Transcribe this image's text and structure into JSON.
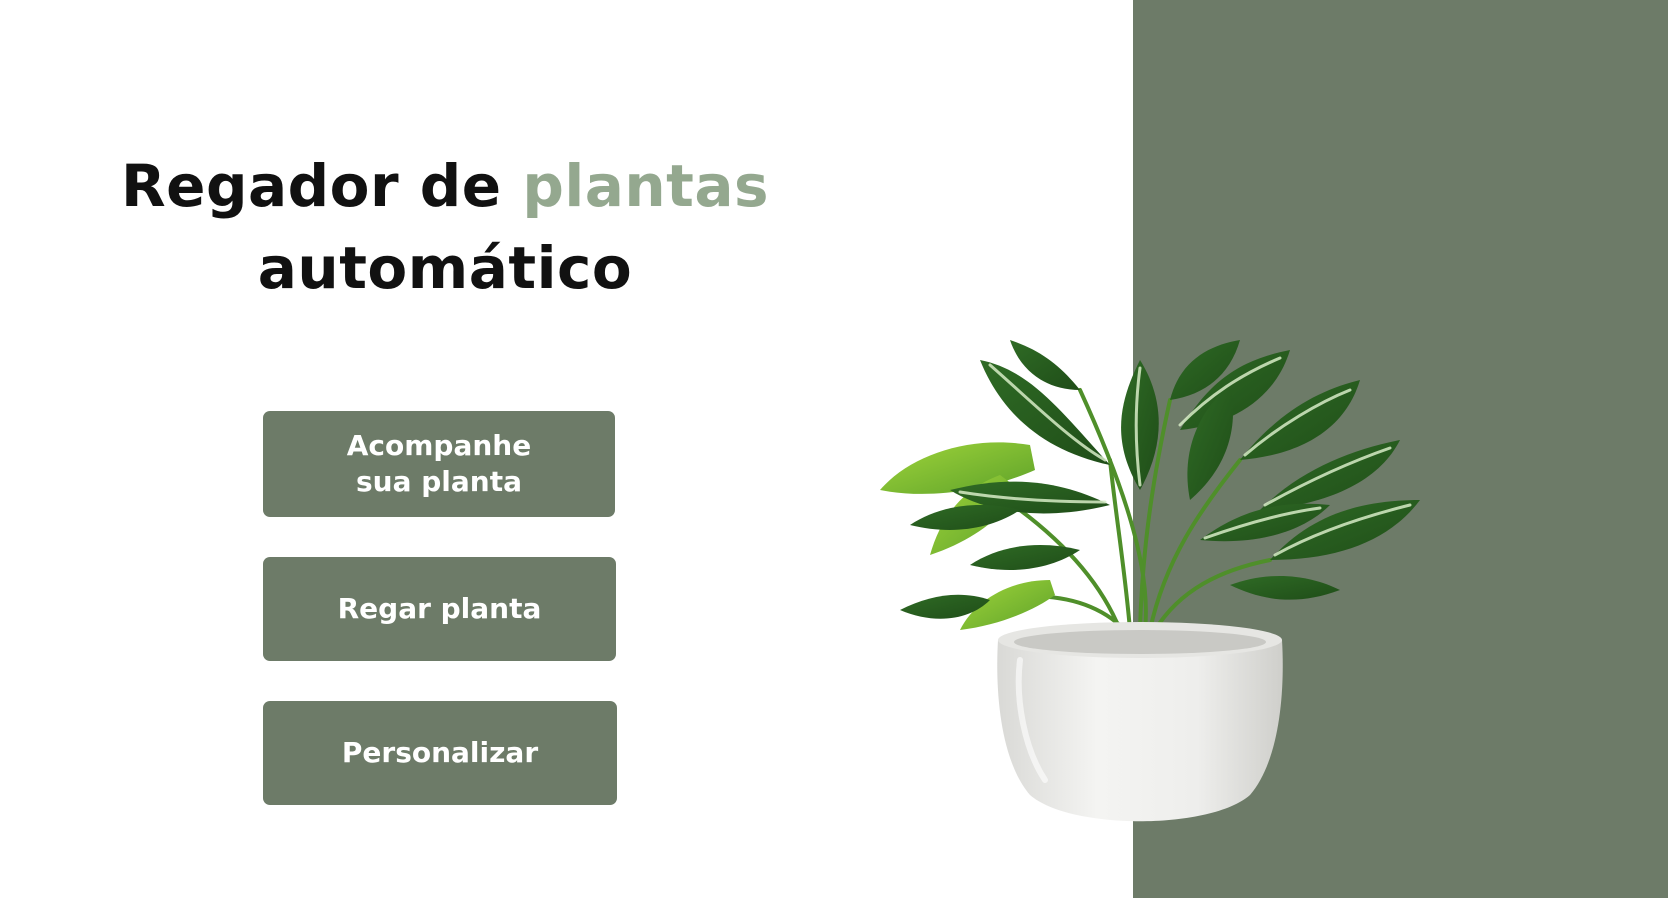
{
  "header": {
    "title_part1": "Regador de ",
    "title_accent": "plantas",
    "title_part2": "automático"
  },
  "actions": {
    "track_line1": "Acompanhe",
    "track_line2": "sua planta",
    "water": "Regar planta",
    "customize": "Personalizar"
  },
  "colors": {
    "panel": "#6d7b68",
    "accent_text": "#94a88f",
    "button": "#6d7b68",
    "title": "#111111"
  },
  "illustration": {
    "icon": "potted-plant-icon"
  }
}
